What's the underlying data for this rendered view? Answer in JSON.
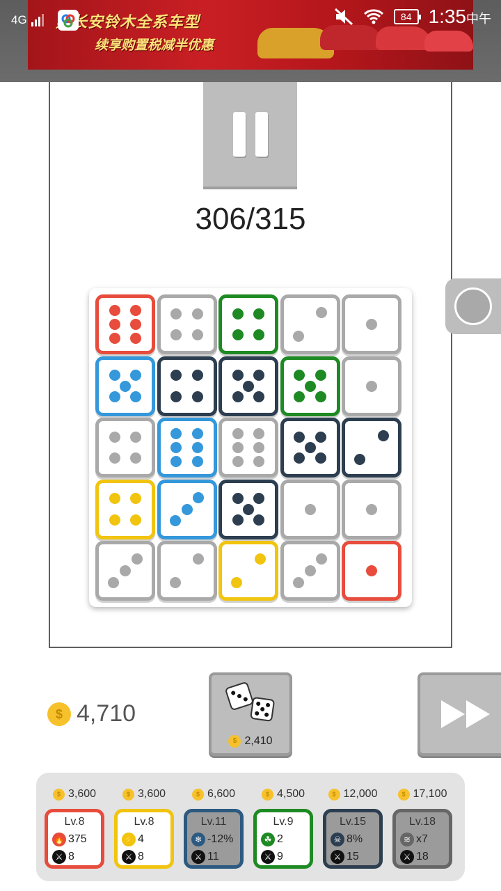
{
  "status_bar": {
    "network": "4G",
    "battery": "84",
    "time": "1:35",
    "time_suffix": "中午"
  },
  "ad": {
    "headline": "购长安铃木全系车型",
    "subline": "续享购置税减半优惠"
  },
  "game": {
    "progress": "306/315",
    "board": [
      [
        {
          "color": "#e74c3c",
          "pips": 6
        },
        {
          "color": "#a9a9a9",
          "pips": 4
        },
        {
          "color": "#1e8a23",
          "pips": 4
        },
        {
          "color": "#a9a9a9",
          "pips": 2
        },
        {
          "color": "#a9a9a9",
          "pips": 1
        }
      ],
      [
        {
          "color": "#3498db",
          "pips": 5
        },
        {
          "color": "#2c3e50",
          "pips": 4
        },
        {
          "color": "#2c3e50",
          "pips": 5
        },
        {
          "color": "#1e8a23",
          "pips": 5
        },
        {
          "color": "#a9a9a9",
          "pips": 1
        }
      ],
      [
        {
          "color": "#a9a9a9",
          "pips": 4
        },
        {
          "color": "#3498db",
          "pips": 6
        },
        {
          "color": "#a9a9a9",
          "pips": 6
        },
        {
          "color": "#2c3e50",
          "pips": 5
        },
        {
          "color": "#2c3e50",
          "pips": 2
        }
      ],
      [
        {
          "color": "#f1c40f",
          "pips": 4
        },
        {
          "color": "#3498db",
          "pips": 3
        },
        {
          "color": "#2c3e50",
          "pips": 5
        },
        {
          "color": "#a9a9a9",
          "pips": 1
        },
        {
          "color": "#a9a9a9",
          "pips": 1
        }
      ],
      [
        {
          "color": "#a9a9a9",
          "pips": 3
        },
        {
          "color": "#a9a9a9",
          "pips": 2
        },
        {
          "color": "#f1c40f",
          "pips": 2
        },
        {
          "color": "#a9a9a9",
          "pips": 3
        },
        {
          "color": "#e74c3c",
          "pips": 1
        }
      ]
    ]
  },
  "wallet": {
    "coins": "4,710"
  },
  "roll_button": {
    "cost": "2,410"
  },
  "upgrades": [
    {
      "price": "3,600",
      "level": "Lv.8",
      "stat": "375",
      "power": "8",
      "color": "#e74c3c",
      "icon": "fire-icon",
      "locked": false
    },
    {
      "price": "3,600",
      "level": "Lv.8",
      "stat": "4",
      "power": "8",
      "color": "#f1c40f",
      "icon": "lightning-icon",
      "locked": false
    },
    {
      "price": "6,600",
      "level": "Lv.11",
      "stat": "-12%",
      "power": "11",
      "color": "#2c5a80",
      "icon": "snowflake-icon",
      "locked": true
    },
    {
      "price": "4,500",
      "level": "Lv.9",
      "stat": "2",
      "power": "9",
      "color": "#1e8a23",
      "icon": "poison-icon",
      "locked": false
    },
    {
      "price": "12,000",
      "level": "Lv.15",
      "stat": "8%",
      "power": "15",
      "color": "#2c3e50",
      "icon": "skull-icon",
      "locked": true
    },
    {
      "price": "17,100",
      "level": "Lv.18",
      "stat": "x7",
      "power": "18",
      "color": "#666666",
      "icon": "wind-icon",
      "locked": true
    }
  ]
}
